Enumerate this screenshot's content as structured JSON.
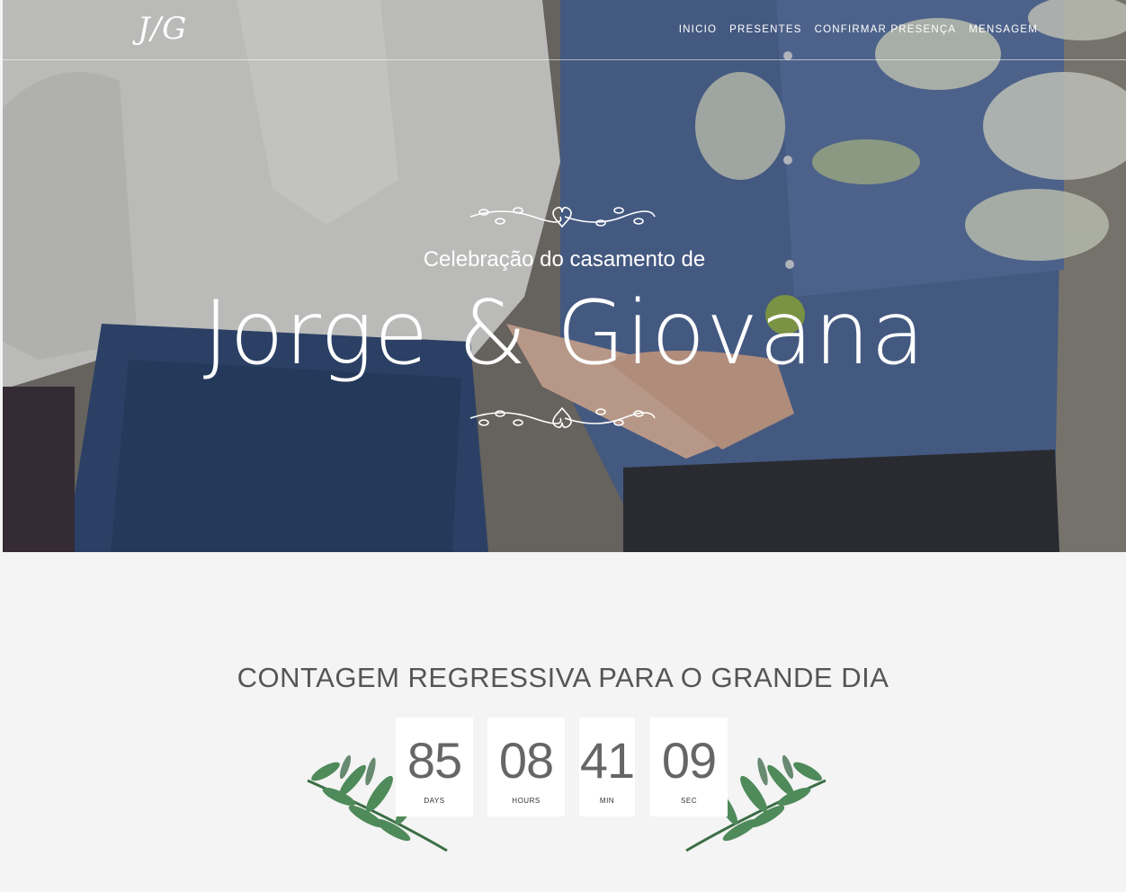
{
  "header": {
    "logo": "J/G",
    "nav": [
      "INICIO",
      "PRESENTES",
      "CONFIRMAR PRESENÇA",
      "MENSAGEM"
    ]
  },
  "hero": {
    "subtitle": "Celebração do casamento de",
    "names": "Jorge & Giovana"
  },
  "countdown": {
    "title": "CONTAGEM REGRESSIVA PARA O GRANDE DIA",
    "units": [
      {
        "value": "85",
        "label": "DAYS"
      },
      {
        "value": "08",
        "label": "HOURS"
      },
      {
        "value": "41",
        "label": "MIN"
      },
      {
        "value": "09",
        "label": "SEC"
      }
    ]
  },
  "colors": {
    "page_bg": "#f4f4f4",
    "text_gray": "#555555",
    "leaf_green": "#4f8a5a"
  }
}
